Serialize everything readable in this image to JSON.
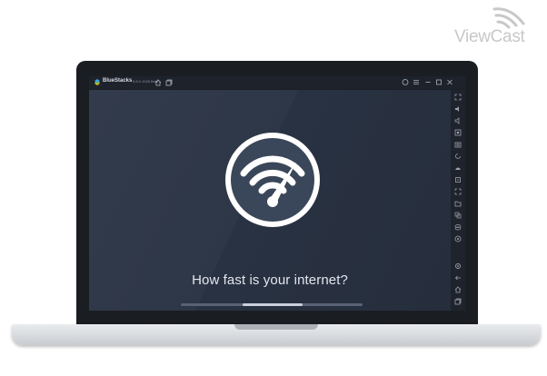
{
  "watermark": {
    "text": "ViewCast"
  },
  "window": {
    "app_name": "BlueStacks",
    "version": "5.8.0.1028 Beta"
  },
  "app": {
    "tagline": "How fast is your internet?",
    "progress": 0.33
  },
  "icons": {
    "titlebar_left": [
      "home-icon",
      "multi-instance-icon"
    ],
    "titlebar_right": [
      "help-icon",
      "menu-icon",
      "minimize-icon",
      "maximize-icon",
      "close-icon"
    ],
    "sidebar": [
      "fullscreen-icon",
      "volume-up-icon",
      "volume-down-icon",
      "screen-record-icon",
      "screenshot-icon",
      "rotate-icon",
      "shake-icon",
      "apk-install-icon",
      "macro-icon",
      "folder-icon",
      "multi-sync-icon",
      "eco-mode-icon",
      "location-icon",
      "settings-icon",
      "back-icon",
      "home-icon",
      "recent-apps-icon"
    ]
  },
  "colors": {
    "screen_bg": "#2e3747",
    "logo_bg": "#3a4659",
    "logo_ring": "#ffffff",
    "text": "#e2e6ee"
  }
}
